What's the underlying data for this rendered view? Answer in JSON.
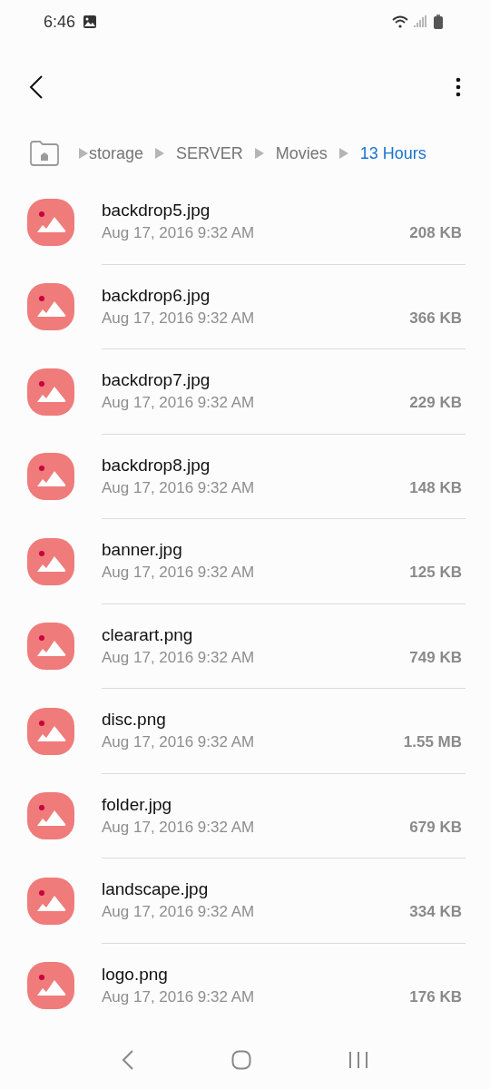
{
  "status_bar": {
    "time": "6:46"
  },
  "breadcrumbs": [
    {
      "label": "storage",
      "selected": false
    },
    {
      "label": "SERVER",
      "selected": false
    },
    {
      "label": "Movies",
      "selected": false
    },
    {
      "label": "13 Hours",
      "selected": true
    }
  ],
  "files": [
    {
      "name": "backdrop5.jpg",
      "date": "Aug 17, 2016 9:32 AM",
      "size": "208 KB"
    },
    {
      "name": "backdrop6.jpg",
      "date": "Aug 17, 2016 9:32 AM",
      "size": "366 KB"
    },
    {
      "name": "backdrop7.jpg",
      "date": "Aug 17, 2016 9:32 AM",
      "size": "229 KB"
    },
    {
      "name": "backdrop8.jpg",
      "date": "Aug 17, 2016 9:32 AM",
      "size": "148 KB"
    },
    {
      "name": "banner.jpg",
      "date": "Aug 17, 2016 9:32 AM",
      "size": "125 KB"
    },
    {
      "name": "clearart.png",
      "date": "Aug 17, 2016 9:32 AM",
      "size": "749 KB"
    },
    {
      "name": "disc.png",
      "date": "Aug 17, 2016 9:32 AM",
      "size": "1.55 MB"
    },
    {
      "name": "folder.jpg",
      "date": "Aug 17, 2016 9:32 AM",
      "size": "679 KB"
    },
    {
      "name": "landscape.jpg",
      "date": "Aug 17, 2016 9:32 AM",
      "size": "334 KB"
    },
    {
      "name": "logo.png",
      "date": "Aug 17, 2016 9:32 AM",
      "size": "176 KB"
    }
  ]
}
